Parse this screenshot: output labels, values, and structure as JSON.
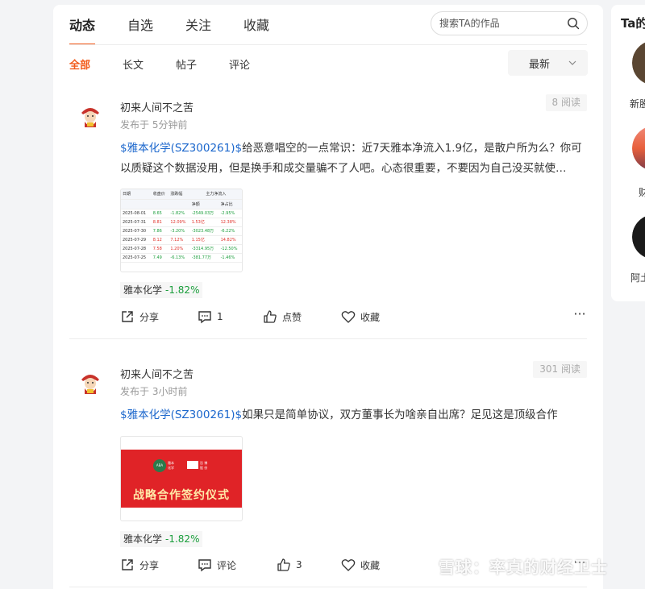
{
  "tabs": [
    "动态",
    "自选",
    "关注",
    "收藏"
  ],
  "search": {
    "placeholder": "搜索TA的作品"
  },
  "subtabs": [
    "全部",
    "长文",
    "帖子",
    "评论"
  ],
  "sort": {
    "label": "最新"
  },
  "posts": [
    {
      "author": "初来人间不之苦",
      "time": "发布于 5分钟前",
      "reads": "8 阅读",
      "stock_link": "$雅本化学(SZ300261)$",
      "text": "给恶意唱空的一点常识：近7天雅本净流入1.9亿，是散户所为么？你可以质疑这个数据没用，但是换手和成交量骗不了人吧。心态很重要，不要因为自己没买就使…",
      "image": {
        "headers": [
          "日期",
          "收盘价",
          "涨跌幅",
          "主力净流入",
          "净额",
          "净占比"
        ],
        "rows": [
          [
            "2025-08-01",
            "8.65",
            "-1.82%",
            "-2549.03万",
            "-2.95%"
          ],
          [
            "2025-07-31",
            "8.81",
            "12.09%",
            "1.53亿",
            "12.38%"
          ],
          [
            "2025-07-30",
            "7.86",
            "-3.20%",
            "-3023.48万",
            "-6.22%"
          ],
          [
            "2025-07-29",
            "8.12",
            "7.12%",
            "1.15亿",
            "14.82%"
          ],
          [
            "2025-07-28",
            "7.58",
            "1.20%",
            "-3314.95万",
            "-12.50%"
          ],
          [
            "2025-07-25",
            "7.49",
            "-6.13%",
            "-381.77万",
            "-1.46%"
          ]
        ]
      },
      "quote": {
        "name": "雅本化学",
        "change": "-1.82%"
      },
      "actions": {
        "share": "分享",
        "comment": "1",
        "like": "点赞",
        "fav": "收藏"
      }
    },
    {
      "author": "初来人间不之苦",
      "time": "发布于 3小时前",
      "reads": "301 阅读",
      "stock_link": "$雅本化学(SZ300261)$",
      "text": "如果只是简单协议，双方董事长为啥亲自出席？足见这是顶级合作",
      "image": {
        "banner_title": "战略合作签约仪式",
        "logo_left_mark": "ABA",
        "logo_left_text": [
          "雅本",
          "化学"
        ],
        "logo_right_text": [
          "旨 博",
          "股 份"
        ]
      },
      "quote": {
        "name": "雅本化学",
        "change": "-1.82%"
      },
      "actions": {
        "share": "分享",
        "comment": "评论",
        "like": "3",
        "fav": "收藏"
      }
    }
  ],
  "sidebar": {
    "title": "Ta的",
    "users": [
      "新股",
      "财",
      "阿土"
    ]
  },
  "watermark": "雪球：率真的财经卫士",
  "colors": {
    "accent": "#f25a1a",
    "link": "#1a66cc",
    "down": "#1a9e3b",
    "up": "#e0312a"
  }
}
